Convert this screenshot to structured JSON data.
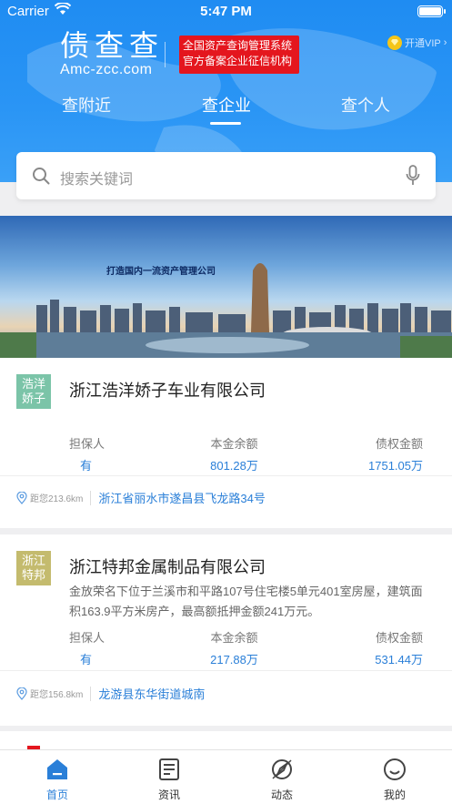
{
  "status_bar": {
    "carrier": "Carrier",
    "time": "5:47 PM"
  },
  "header": {
    "brand_cn": "债查查",
    "brand_en": "Amc-zcc.com",
    "slogan_line1": "全国资产查询管理系统",
    "slogan_line2": "官方备案企业征信机构",
    "vip_label": "开通VIP",
    "tabs": [
      {
        "label": "查附近"
      },
      {
        "label": "查企业",
        "active": true
      },
      {
        "label": "查个人"
      }
    ]
  },
  "search": {
    "placeholder": "搜索关键词"
  },
  "banner": {
    "text": "打造国内一流资产管理公司"
  },
  "companies": [
    {
      "logo_text_1": "浩洋",
      "logo_text_2": "娇子",
      "logo_color": "#7bc4a8",
      "name": "浙江浩洋娇子车业有限公司",
      "description": "",
      "guarantor_label": "担保人",
      "guarantor_value": "有",
      "principal_label": "本金余额",
      "principal_value": "801.28万",
      "claim_label": "债权金额",
      "claim_value": "1751.05万",
      "distance": "距您213.6km",
      "address": "浙江省丽水市遂昌县飞龙路34号"
    },
    {
      "logo_text_1": "浙江",
      "logo_text_2": "特邦",
      "logo_color": "#c4bb6e",
      "name": "浙江特邦金属制品有限公司",
      "description": "金放荣名下位于兰溪市和平路107号住宅楼5单元401室房屋，建筑面积163.9平方米房产，最高额抵押金额241万元。",
      "guarantor_label": "担保人",
      "guarantor_value": "有",
      "principal_label": "本金余额",
      "principal_value": "217.88万",
      "claim_label": "债权金额",
      "claim_value": "531.44万",
      "distance": "距您156.8km",
      "address": "龙游县东华街道城南"
    }
  ],
  "tabbar": [
    {
      "label": "首页",
      "icon": "home-icon",
      "active": true
    },
    {
      "label": "资讯",
      "icon": "news-icon"
    },
    {
      "label": "动态",
      "icon": "compass-icon"
    },
    {
      "label": "我的",
      "icon": "profile-icon"
    }
  ],
  "colors": {
    "primary": "#2a7fd8",
    "header": "#1f8cf2",
    "slogan_bg": "#e4161e"
  }
}
